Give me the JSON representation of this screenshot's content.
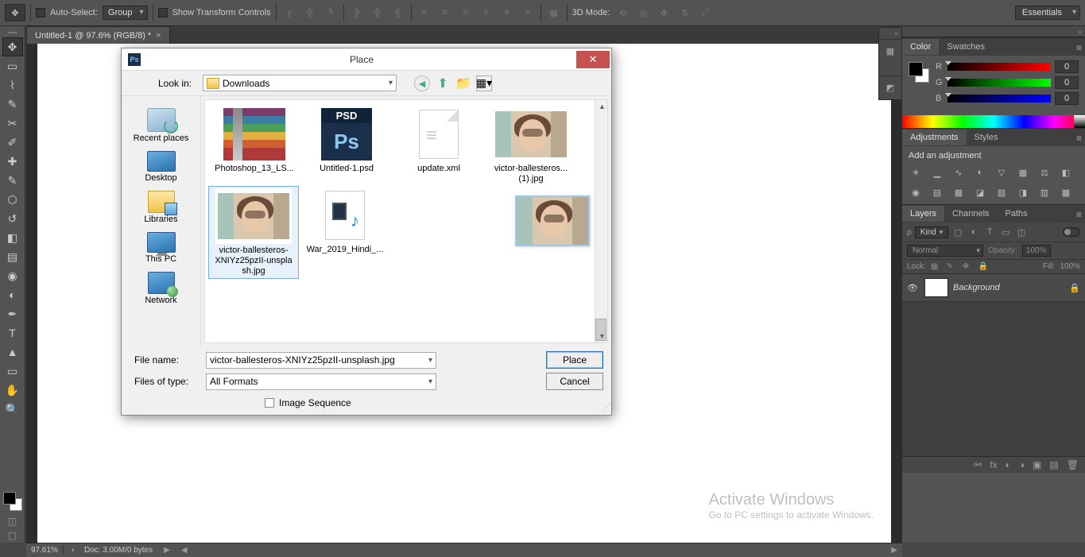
{
  "optbar": {
    "auto_select": "Auto-Select:",
    "group": "Group",
    "show_transform": "Show Transform Controls",
    "mode3d": "3D Mode:",
    "workspace": "Essentials"
  },
  "tab": {
    "title": "Untitled-1 @ 97.6% (RGB/8) *"
  },
  "panels": {
    "color": {
      "tab1": "Color",
      "tab2": "Swatches",
      "r_label": "R",
      "g_label": "G",
      "b_label": "B",
      "r": "0",
      "g": "0",
      "b": "0"
    },
    "adjust": {
      "tab1": "Adjustments",
      "tab2": "Styles",
      "heading": "Add an adjustment"
    },
    "layers": {
      "tab1": "Layers",
      "tab2": "Channels",
      "tab3": "Paths",
      "kind": "Kind",
      "blend": "Normal",
      "opacity_lab": "Opacity:",
      "opacity_val": "100%",
      "lock_lab": "Lock:",
      "fill_lab": "Fill:",
      "fill_val": "100%",
      "layer_name": "Background"
    }
  },
  "status": {
    "zoom": "97.61%",
    "doc": "Doc: 3.00M/0 bytes"
  },
  "watermark": {
    "l1": "Activate Windows",
    "l2": "Go to PC settings to activate Windows."
  },
  "dialog": {
    "title": "Place",
    "lookin_label": "Look in:",
    "lookin_value": "Downloads",
    "places": {
      "recent": "Recent places",
      "desktop": "Desktop",
      "libraries": "Libraries",
      "thispc": "This PC",
      "network": "Network"
    },
    "files": {
      "f0": "Photoshop_13_LS...",
      "f1": "Untitled-1.psd",
      "f2": "update.xml",
      "f3_a": "victor-ballesteros...",
      "f3_b": "(1).jpg",
      "f4_a": "victor-ballesteros-",
      "f4_b": "XNIYz25pzII-unspla",
      "f4_c": "sh.jpg",
      "f5": "War_2019_Hindi_..."
    },
    "filename_label": "File name:",
    "filename_value": "victor-ballesteros-XNIYz25pzII-unsplash.jpg",
    "filetype_label": "Files of type:",
    "filetype_value": "All Formats",
    "place_btn": "Place",
    "cancel_btn": "Cancel",
    "image_seq": "Image Sequence"
  }
}
